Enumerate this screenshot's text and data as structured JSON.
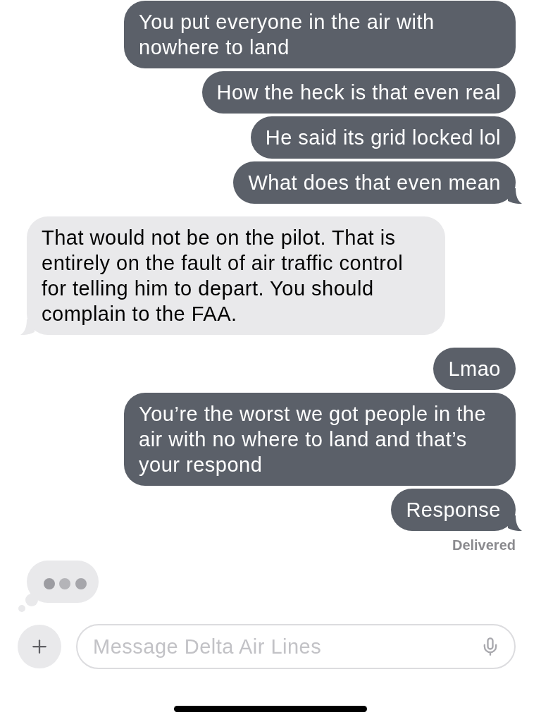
{
  "messages": [
    {
      "kind": "sent",
      "text": "You put everyone in the air with nowhere to land"
    },
    {
      "kind": "sent",
      "text": "How the heck is that even real"
    },
    {
      "kind": "sent",
      "text": "He said its grid locked lol"
    },
    {
      "kind": "sent",
      "text": "What does that even mean"
    },
    {
      "kind": "received",
      "text": "That would not be on the pilot. That is entirely on the fault of air traffic control for telling him to depart. You should complain to the FAA."
    },
    {
      "kind": "sent",
      "text": "Lmao"
    },
    {
      "kind": "sent",
      "text": "You’re the worst we got people in the air with no where to land and that’s your respond"
    },
    {
      "kind": "sent",
      "text": "Response"
    }
  ],
  "delivery_status": "Delivered",
  "typing": true,
  "composer": {
    "placeholder": "Message Delta Air Lines"
  }
}
